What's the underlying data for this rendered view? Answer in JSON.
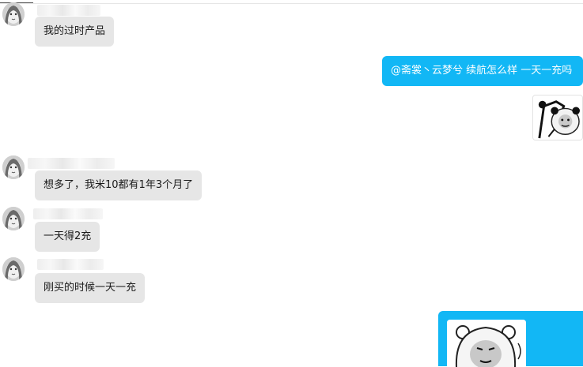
{
  "messages": [
    {
      "side": "in",
      "text": "我的过时产品"
    },
    {
      "side": "out",
      "text": "@斋裳丶云梦兮 续航怎么样  一天一充吗"
    },
    {
      "side": "in",
      "text": "想多了，我米10都有1年3个月了"
    },
    {
      "side": "in",
      "text": "一天得2充"
    },
    {
      "side": "in",
      "text": "刚买的时候一天一充"
    }
  ],
  "stickers": [
    {
      "icon": "panda-meme-sticker-icon"
    },
    {
      "icon": "panda-meme-face-icon"
    }
  ],
  "colors": {
    "outgoing_bubble": "#12b7f5",
    "incoming_bubble": "#e6e6e6",
    "background": "#ffffff"
  }
}
